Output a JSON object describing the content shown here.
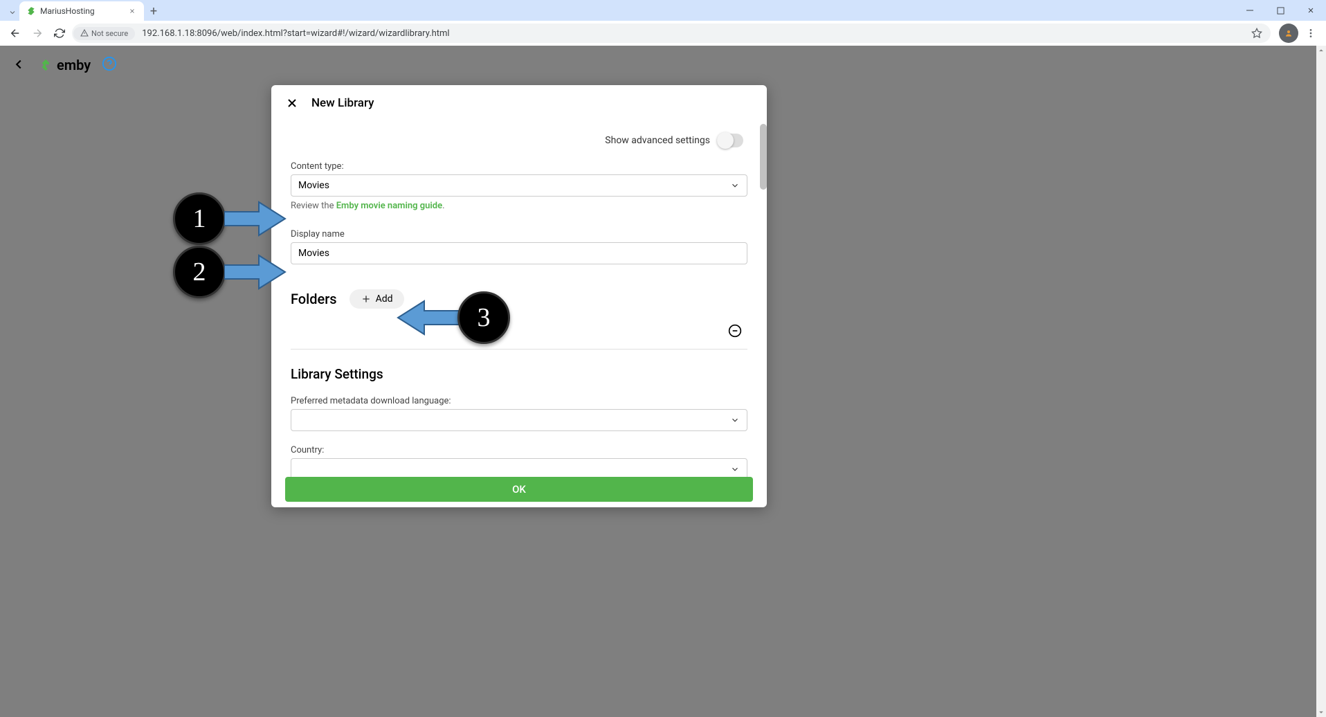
{
  "browser": {
    "tab_title": "MariusHosting",
    "security_label": "Not secure",
    "url": "192.168.1.18:8096/web/index.html?start=wizard#!/wizard/wizardlibrary.html"
  },
  "app": {
    "brand": "emby"
  },
  "dialog": {
    "title": "New Library",
    "advanced_label": "Show advanced settings",
    "content_type_label": "Content type:",
    "content_type_value": "Movies",
    "helper_prefix": "Review the ",
    "helper_link": "Emby movie naming guide",
    "helper_suffix": ".",
    "display_name_label": "Display name",
    "display_name_value": "Movies",
    "folders_title": "Folders",
    "add_label": "Add",
    "lib_settings_title": "Library Settings",
    "metadata_lang_label": "Preferred metadata download language:",
    "metadata_lang_value": "",
    "country_label": "Country:",
    "country_value": "",
    "ok_label": "OK"
  },
  "annotations": {
    "one": "1",
    "two": "2",
    "three": "3"
  }
}
